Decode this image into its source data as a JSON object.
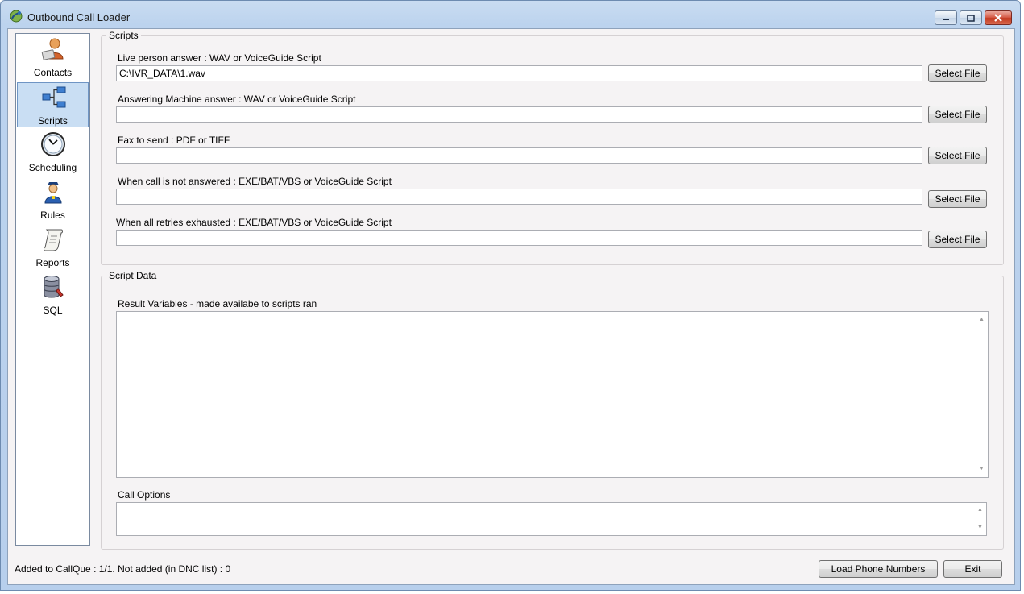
{
  "window": {
    "title": "Outbound Call Loader"
  },
  "sidebar": {
    "items": [
      {
        "label": "Contacts",
        "icon": "contacts-icon"
      },
      {
        "label": "Scripts",
        "icon": "scripts-icon",
        "active": true
      },
      {
        "label": "Scheduling",
        "icon": "clock-icon"
      },
      {
        "label": "Rules",
        "icon": "rules-icon"
      },
      {
        "label": "Reports",
        "icon": "scroll-icon"
      },
      {
        "label": "SQL",
        "icon": "database-icon"
      }
    ]
  },
  "scripts_group": {
    "legend": "Scripts",
    "fields": [
      {
        "label": "Live person answer : WAV or VoiceGuide Script",
        "value": "C:\\IVR_DATA\\1.wav",
        "button": "Select File"
      },
      {
        "label": "Answering Machine answer : WAV or VoiceGuide Script",
        "value": "",
        "button": "Select File"
      },
      {
        "label": "Fax to send : PDF or TIFF",
        "value": "",
        "button": "Select File"
      },
      {
        "label": "When call is not answered : EXE/BAT/VBS or VoiceGuide Script",
        "value": "",
        "button": "Select File"
      },
      {
        "label": "When all retries exhausted : EXE/BAT/VBS or VoiceGuide Script",
        "value": "",
        "button": "Select File"
      }
    ]
  },
  "script_data_group": {
    "legend": "Script Data",
    "result_label": "Result Variables - made availabe to scripts ran",
    "result_value": "",
    "call_options_label": "Call Options",
    "call_options_value": ""
  },
  "footer": {
    "status": "Added to CallQue : 1/1. Not added (in DNC list) : 0",
    "load_button": "Load Phone Numbers",
    "exit_button": "Exit"
  }
}
